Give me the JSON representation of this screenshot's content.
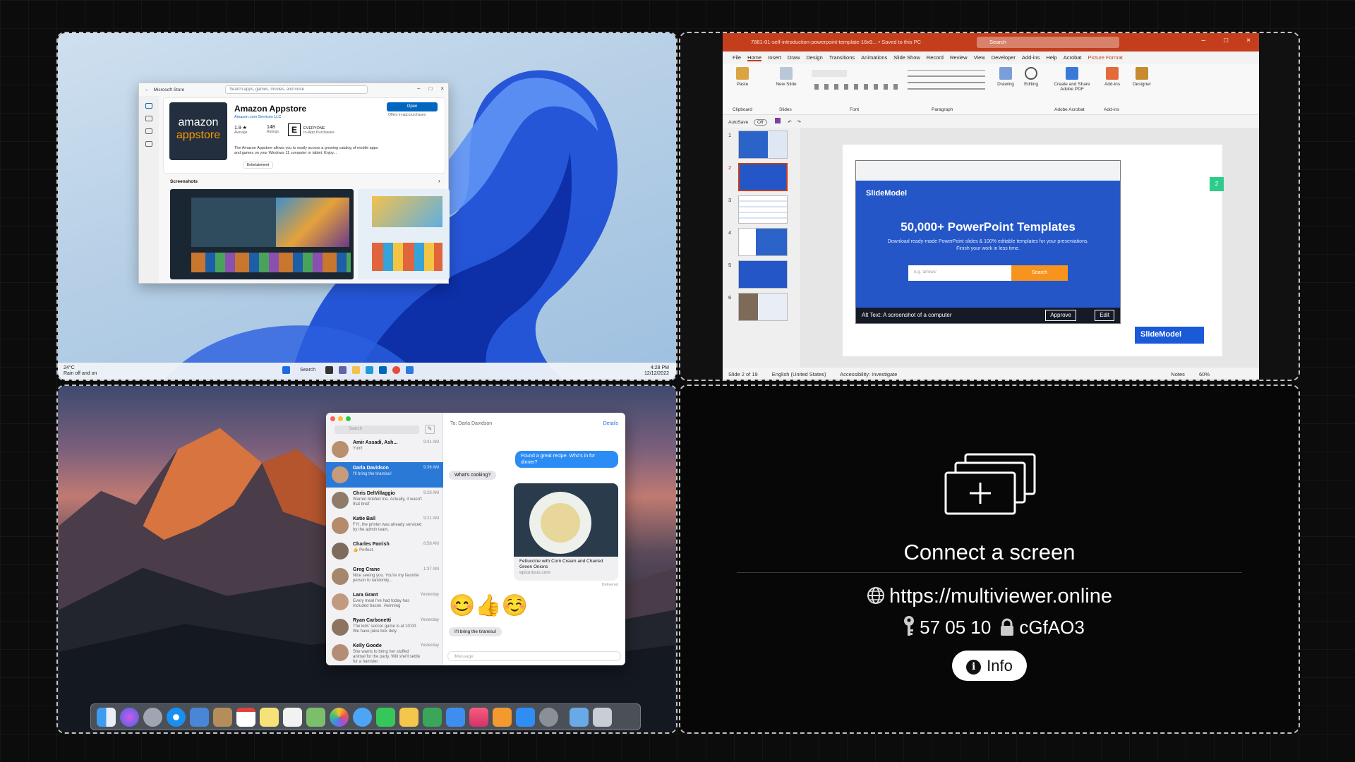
{
  "windows": {
    "store": {
      "title": "Microsoft Store",
      "search_placeholder": "Search apps, games, movies, and more",
      "logo_line1": "amazon",
      "logo_line2": "appstore",
      "app_name": "Amazon Appstore",
      "publisher": "Amazon.com Services LLC",
      "rating": "1.9 ★",
      "rating_label": "Average",
      "ratings_count": "148",
      "ratings_label": "Ratings",
      "esrb": "E",
      "esrb_label": "EVERYONE",
      "esrb_sub": "In-App Purchases",
      "description": "The Amazon Appstore allows you to easily access a growing catalog of mobile apps and games on your Windows 11 computer or tablet. Enjoy...",
      "tag": "Entertainment",
      "open_label": "Open",
      "open_sub": "Offers in-app purchases",
      "screenshots_label": "Screenshots"
    },
    "taskbar": {
      "weather_temp": "24°C",
      "weather_text": "Rain off and on",
      "search_label": "Search",
      "time": "4:28 PM",
      "date": "12/12/2022"
    }
  },
  "powerpoint": {
    "title": "7881-01-self-introduction-powerpoint-template-16x9... • Saved to this PC",
    "search_placeholder": "Search",
    "menu": [
      "File",
      "Home",
      "Insert",
      "Draw",
      "Design",
      "Transitions",
      "Animations",
      "Slide Show",
      "Record",
      "Review",
      "View",
      "Developer",
      "Add-ins",
      "Help",
      "Acrobat",
      "Picture Format"
    ],
    "ribbon": {
      "paste": "Paste",
      "new_slide": "New Slide",
      "clipboard": "Clipboard",
      "slides": "Slides",
      "font": "Font",
      "paragraph": "Paragraph",
      "drawing": "Drawing",
      "editing": "Editing",
      "create_share": "Create and Share Adobe PDF",
      "adobe_acrobat": "Adobe Acrobat",
      "addins": "Add-ins",
      "designer": "Designer"
    },
    "autosave": "AutoSave",
    "autosave_state": "Off",
    "thumb_numbers": [
      "1",
      "2",
      "3",
      "4",
      "5",
      "6"
    ],
    "slide": {
      "logo": "SlideModel",
      "headline": "50,000+ PowerPoint Templates",
      "sub": "Download ready-made PowerPoint slides & 100% editable templates for your presentations. Finish your work in less time.",
      "search_hint": "e.g. 'arrows'",
      "search_btn": "Search",
      "alt_text": "Alt Text: A screenshot of a computer",
      "approve": "Approve",
      "edit": "Edit",
      "badge": "2"
    },
    "status": {
      "slide_info": "Slide 2 of 19",
      "language": "English (United States)",
      "accessibility": "Accessibility: Investigate",
      "notes": "Notes",
      "zoom": "60%"
    }
  },
  "mac": {
    "messages": {
      "search_placeholder": "Search",
      "to_label": "To:  Darla Davidson",
      "details": "Details",
      "conversations": [
        {
          "name": "Amir Assadi, Ash...",
          "time": "9:41 AM",
          "preview": "Yum!"
        },
        {
          "name": "Darla Davidson",
          "time": "9:36 AM",
          "preview": "I'll bring the tiramisu!"
        },
        {
          "name": "Chris DelVillaggio",
          "time": "9:28 AM",
          "preview": "Warren briefed me. Actually, it wasn't that brief"
        },
        {
          "name": "Katie Ball",
          "time": "9:21 AM",
          "preview": "FYI, the printer was already serviced by the admin team."
        },
        {
          "name": "Charles Parrish",
          "time": "8:58 AM",
          "preview": "👍 Perfect."
        },
        {
          "name": "Greg Crane",
          "time": "1:37 AM",
          "preview": "Nice seeing you. You're my favorite person to randomly..."
        },
        {
          "name": "Lara Grant",
          "time": "Yesterday",
          "preview": "Every meal I've had today has included bacon. #winning"
        },
        {
          "name": "Ryan Carbonetti",
          "time": "Yesterday",
          "preview": "The kids' soccer game is at 10:00. We have juice box duty."
        },
        {
          "name": "Kelly Goode",
          "time": "Yesterday",
          "preview": "She wants to bring her stuffed animal for the party. Will she'll settle for a hamster."
        }
      ],
      "bubble_out": "Found a great recipe. Who's in for dinner?",
      "bubble_in": "What's cooking?",
      "food_caption": "Fettuccine with Corn Cream and Charred Green Onions",
      "food_source": "epicurious.com",
      "delivered": "Delivered",
      "emojis": "😊👍☺️",
      "last_in": "I'll bring the tiramisu!",
      "input_placeholder": "iMessage"
    }
  },
  "connect": {
    "title": "Connect a screen",
    "url": "https://multiviewer.online",
    "id": "57 05 10",
    "code": "cGfAO3",
    "info_label": "Info"
  },
  "accent": {
    "ppt_red": "#c43e1c",
    "mac_blue": "#2a79d6",
    "win_blue": "#0067c0"
  }
}
